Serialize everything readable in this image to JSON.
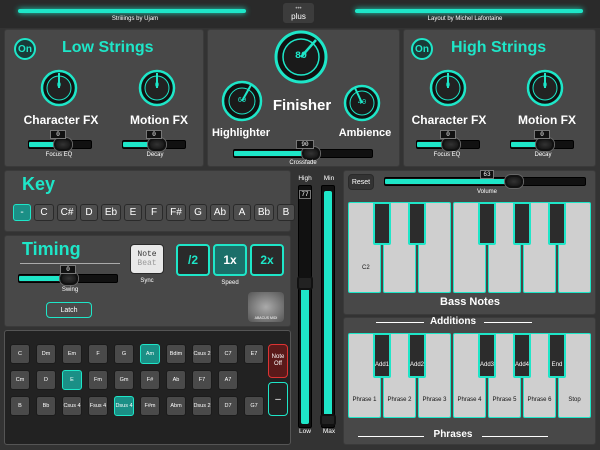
{
  "header": {
    "left_credit": "Striiiings by Ujam",
    "right_credit": "Layout by Michel Lafontaine",
    "center_badge": "plus",
    "accent": "#1ee6c8"
  },
  "low_strings": {
    "on_label": "On",
    "title": "Low Strings",
    "character_fx": {
      "label": "Character FX",
      "value": "0"
    },
    "motion_fx": {
      "label": "Motion FX",
      "value": "0"
    },
    "focus_eq": {
      "label": "Focus EQ",
      "value": "0",
      "level": 0.5
    },
    "decay": {
      "label": "Decay",
      "value": "0",
      "level": 0.5
    }
  },
  "finisher": {
    "title": "Finisher",
    "main_value": "80",
    "highlighter": {
      "label": "Highlighter",
      "value": "69"
    },
    "ambience": {
      "label": "Ambience",
      "value": "40"
    },
    "crossfade": {
      "label": "Crossfade",
      "value": "90",
      "level": 0.9
    }
  },
  "high_strings": {
    "on_label": "On",
    "title": "High Strings",
    "character_fx": {
      "label": "Character FX",
      "value": "0"
    },
    "motion_fx": {
      "label": "Motion FX",
      "value": "0"
    },
    "focus_eq": {
      "label": "Focus EQ",
      "value": "0",
      "level": 0.5
    },
    "decay": {
      "label": "Decay",
      "value": "0",
      "level": 0.5
    }
  },
  "key": {
    "title": "Key",
    "keys": [
      "-",
      "C",
      "C#",
      "D",
      "Eb",
      "E",
      "F",
      "F#",
      "G",
      "Ab",
      "A",
      "Bb",
      "B"
    ],
    "selected": "-"
  },
  "timing": {
    "title": "Timing",
    "note_label": "Note",
    "beat_label": "Beat",
    "sync_label": "Sync",
    "speed_options": [
      "/2",
      "1x",
      "2x"
    ],
    "speed_label": "Speed",
    "swing": {
      "label": "Swing",
      "value": "0",
      "level": 0.5
    },
    "latch_label": "Latch",
    "logo_text": "ABACUS MIDI"
  },
  "chords": {
    "rows": [
      [
        "C",
        "Dm",
        "Em",
        "F",
        "G",
        "Am",
        "Bdim",
        "Csus 2",
        "C7",
        "E7"
      ],
      [
        "Cm",
        "D",
        "E",
        "Fm",
        "Gm",
        "F#",
        "Ab",
        "F7",
        "A7"
      ],
      [
        "B",
        "Bb",
        "Csus 4",
        "Fsus 4",
        "Dsus 4",
        "F#m",
        "Abm",
        "Dsus 2",
        "D7",
        "G7"
      ]
    ],
    "active": [
      "Am",
      "E",
      "Dsus 4"
    ],
    "note_off": "Note Off",
    "minus": "–"
  },
  "range": {
    "high_label": "High",
    "min_label": "Min",
    "low_label": "Low",
    "max_label": "Max",
    "high_value": "77"
  },
  "bass": {
    "reset_label": "Reset",
    "volume": {
      "label": "Volume",
      "value": "63",
      "level": 0.63
    },
    "c2_label": "C2",
    "title": "Bass Notes"
  },
  "phrases": {
    "additions_title": "Additions",
    "title": "Phrases",
    "white": [
      "Phrase 1",
      "Phrase 2",
      "Phrase 3",
      "Phrase 4",
      "Phrase 5",
      "Phrase 6",
      "Stop"
    ],
    "black": [
      "Add1",
      "Add2",
      "Add3",
      "Add4",
      "End"
    ]
  }
}
